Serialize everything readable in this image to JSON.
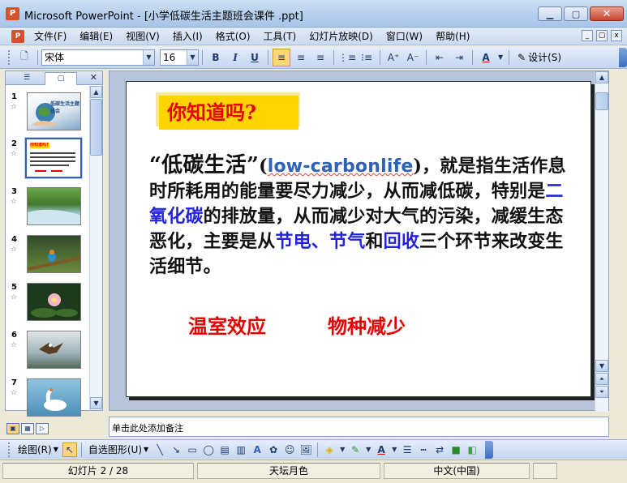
{
  "window": {
    "app_icon": "P",
    "title": "Microsoft PowerPoint - [小学低碳生活主题班会课件 .ppt]",
    "controls": {
      "minimize": "▁",
      "maximize": "▢",
      "close": "✕"
    }
  },
  "menu": {
    "app_icon": "P",
    "items": [
      "文件(F)",
      "编辑(E)",
      "视图(V)",
      "插入(I)",
      "格式(O)",
      "工具(T)",
      "幻灯片放映(D)",
      "窗口(W)",
      "帮助(H)"
    ],
    "doc_controls": [
      "_",
      "▢",
      "x"
    ]
  },
  "toolbar": {
    "new_icon": "🗋",
    "font_name": "宋体",
    "font_size": "16",
    "bold": "B",
    "italic": "I",
    "underline": "U",
    "align_left": "≡",
    "align_center": "≡",
    "align_right": "≡",
    "numbering": "⋮≡",
    "bullets": "⁝≡",
    "grow_font": "A⁺",
    "shrink_font": "A⁻",
    "decrease_indent": "⇤",
    "increase_indent": "⇥",
    "font_color": "A",
    "design_label": "设计(S)"
  },
  "left_panel": {
    "tab_outline": "☰",
    "tab_slides": "▢",
    "close": "✕",
    "slides": [
      {
        "num": "1",
        "star": "☆"
      },
      {
        "num": "2",
        "star": "☆"
      },
      {
        "num": "3",
        "star": "☆"
      },
      {
        "num": "4",
        "star": "☆"
      },
      {
        "num": "5",
        "star": "☆"
      },
      {
        "num": "6",
        "star": "☆"
      },
      {
        "num": "7",
        "star": "☆"
      }
    ],
    "thumb1_caption": "低碳生活主题班会",
    "thumb2_tag": "你知道吗?"
  },
  "slide": {
    "tag": "你知道吗?",
    "quote_open": "“",
    "term": "低碳生活",
    "quote_close": "”",
    "paren_open": "(",
    "english": "low-carbonlife",
    "paren_close": ")",
    "t1": "，就是指生活作息时所耗用的能量要尽力减少，从而减低碳，特别是",
    "co2": "二氧化碳",
    "t2": "的排放量，从而减少对大气的污染，减缓生态恶化，主要是从",
    "save_power": "节电、节气",
    "t3": "和",
    "recycle": "回收",
    "t4": "三个环节来改变生活细节。",
    "red_term1": "温室效应",
    "red_term2": "物种减少"
  },
  "notes": {
    "placeholder": "单击此处添加备注"
  },
  "drawbar": {
    "draw_label": "绘图(R)",
    "autoshape_label": "自选图形(U)"
  },
  "status": {
    "slide_counter": "幻灯片 2 / 28",
    "design": "天坛月色",
    "language": "中文(中国)"
  },
  "colors": {
    "tag_bg": "#ffd400",
    "tag_text": "#e60000",
    "keyword_blue": "#2222dd",
    "english_blue": "#2f62b6",
    "red_terms": "#e60000"
  }
}
